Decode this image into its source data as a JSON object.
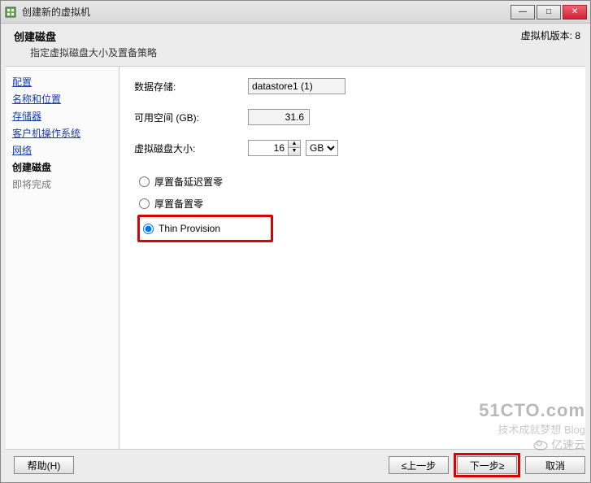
{
  "window": {
    "title": "创建新的虚拟机"
  },
  "winctrl": {
    "min": "—",
    "max": "□",
    "close": "✕"
  },
  "header": {
    "title": "创建磁盘",
    "subtitle": "指定虚拟磁盘大小及置备策略",
    "version": "虚拟机版本: 8"
  },
  "sidebar": {
    "items": [
      {
        "label": "配置",
        "type": "link"
      },
      {
        "label": "名称和位置",
        "type": "link"
      },
      {
        "label": "存储器",
        "type": "link"
      },
      {
        "label": "客户机操作系统",
        "type": "link"
      },
      {
        "label": "网络",
        "type": "link"
      },
      {
        "label": "创建磁盘",
        "type": "current"
      },
      {
        "label": "即将完成",
        "type": "future"
      }
    ]
  },
  "form": {
    "datastore_label": "数据存储:",
    "datastore_value": "datastore1 (1)",
    "freespace_label": "可用空间 (GB):",
    "freespace_value": "31.6",
    "disksize_label": "虚拟磁盘大小:",
    "disksize_value": "16",
    "disksize_unit": "GB",
    "radios": [
      {
        "label": "厚置备延迟置零",
        "checked": false
      },
      {
        "label": "厚置备置零",
        "checked": false
      },
      {
        "label": "Thin Provision",
        "checked": true
      }
    ]
  },
  "footer": {
    "help": "帮助(H)",
    "back": "≤上一步",
    "next": "下一步≥",
    "cancel": "取消"
  },
  "watermark": {
    "w1": "51CTO.com",
    "w2": "技术成就梦想  Blog",
    "w3": "亿速云"
  }
}
